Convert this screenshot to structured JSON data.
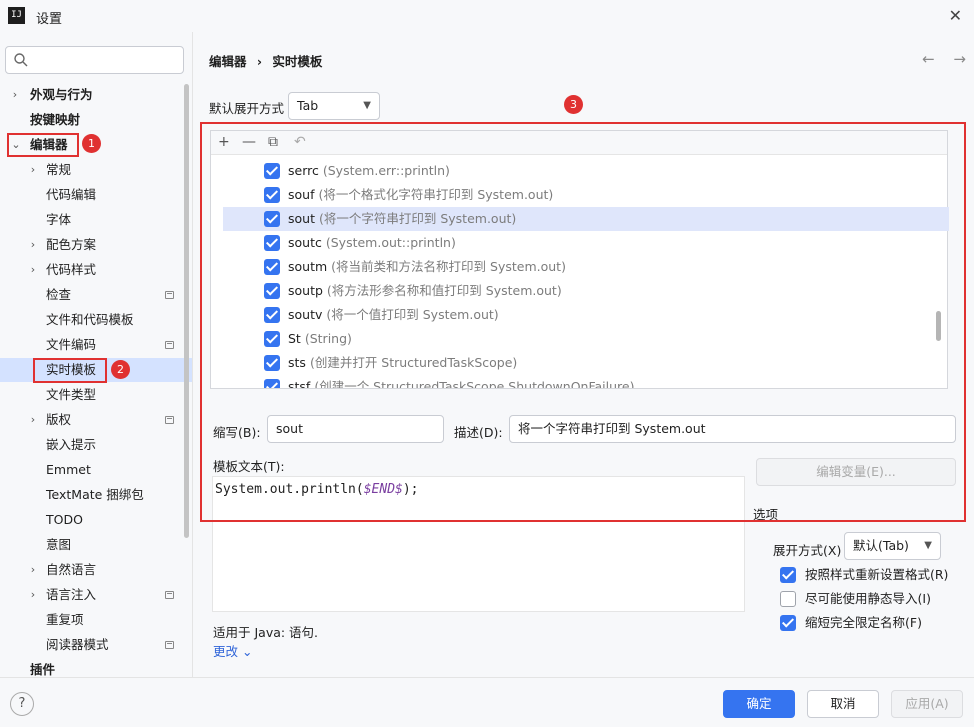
{
  "window": {
    "title": "设置",
    "app_icon_text": "IJ"
  },
  "search": {
    "placeholder": ""
  },
  "sidebar": {
    "items": [
      {
        "label": "外观与行为",
        "chevron": "›"
      },
      {
        "label": "按键映射"
      },
      {
        "label": "编辑器",
        "chevron": "⌄"
      },
      {
        "label": "常规",
        "chevron": "›"
      },
      {
        "label": "代码编辑"
      },
      {
        "label": "字体"
      },
      {
        "label": "配色方案",
        "chevron": "›"
      },
      {
        "label": "代码样式",
        "chevron": "›"
      },
      {
        "label": "检查"
      },
      {
        "label": "文件和代码模板"
      },
      {
        "label": "文件编码"
      },
      {
        "label": "实时模板"
      },
      {
        "label": "文件类型"
      },
      {
        "label": "版权",
        "chevron": "›"
      },
      {
        "label": "嵌入提示"
      },
      {
        "label": "Emmet"
      },
      {
        "label": "TextMate 捆绑包"
      },
      {
        "label": "TODO"
      },
      {
        "label": "意图"
      },
      {
        "label": "自然语言",
        "chevron": "›"
      },
      {
        "label": "语言注入",
        "chevron": "›"
      },
      {
        "label": "重复项"
      },
      {
        "label": "阅读器模式"
      },
      {
        "label": "插件"
      }
    ]
  },
  "annotations": {
    "badge1": "1",
    "badge2": "2",
    "badge3": "3"
  },
  "breadcrumb": {
    "part1": "编辑器",
    "separator": "›",
    "part2": "实时模板"
  },
  "nav": {
    "back": "←",
    "forward": "→"
  },
  "expand": {
    "label": "默认展开方式",
    "value": "Tab"
  },
  "toolbar": {
    "add": "+",
    "remove": "—",
    "copy": "⧉",
    "undo": "↶"
  },
  "templates": [
    {
      "abbr": "serrc",
      "desc": "(System.err::println)"
    },
    {
      "abbr": "souf",
      "desc": "(将一个格式化字符串打印到 System.out)"
    },
    {
      "abbr": "sout",
      "desc": "(将一个字符串打印到 System.out)"
    },
    {
      "abbr": "soutc",
      "desc": "(System.out::println)"
    },
    {
      "abbr": "soutm",
      "desc": "(将当前类和方法名称打印到 System.out)"
    },
    {
      "abbr": "soutp",
      "desc": "(将方法形参名称和值打印到 System.out)"
    },
    {
      "abbr": "soutv",
      "desc": "(将一个值打印到 System.out)"
    },
    {
      "abbr": "St",
      "desc": "(String)"
    },
    {
      "abbr": "sts",
      "desc": "(创建并打开 StructuredTaskScope)"
    },
    {
      "abbr": "stsf",
      "desc": "(创建一个 StructuredTaskScope.ShutdownOnFailure)"
    }
  ],
  "editor": {
    "abbr_label": "缩写(B):",
    "abbr_value": "sout",
    "desc_label": "描述(D):",
    "desc_value": "将一个字符串打印到 System.out",
    "template_text_label": "模板文本(T):",
    "code_prefix": "System.out.println(",
    "code_var": "$END$",
    "code_suffix": ");",
    "edit_vars_button": "编辑变量(E)...",
    "applicable": "适用于 Java: 语句.",
    "change_link": "更改 ⌄"
  },
  "options": {
    "title": "选项",
    "expand_label": "展开方式(X)",
    "expand_value": "默认(Tab)",
    "reformat": "按照样式重新设置格式(R)",
    "static_import": "尽可能使用静态导入(I)",
    "shorten_fq": "缩短完全限定名称(F)"
  },
  "footer": {
    "help": "?",
    "ok": "确定",
    "cancel": "取消",
    "apply": "应用(A)"
  },
  "colors": {
    "accent": "#3574f0",
    "annotation_red": "#e03131",
    "selection": "#d4e2ff"
  }
}
